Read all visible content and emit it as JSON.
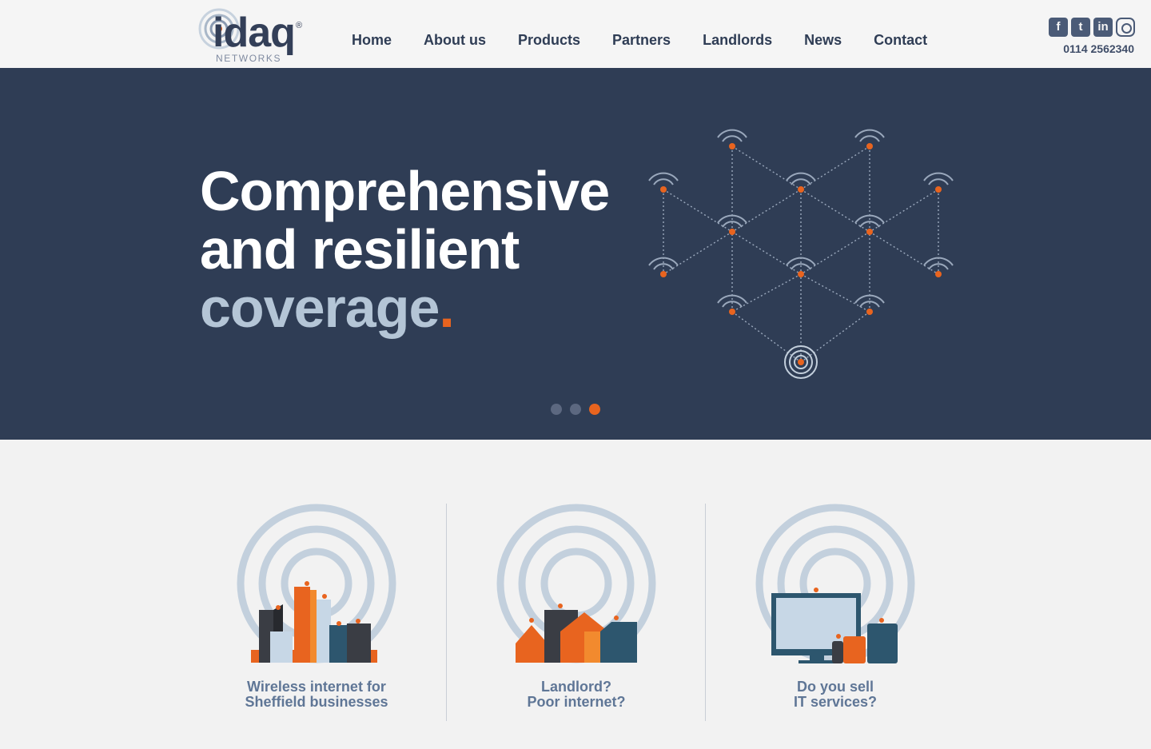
{
  "brand": {
    "name": "idaq",
    "subtitle": "NETWORKS",
    "registered": "®"
  },
  "nav": {
    "items": [
      {
        "label": "Home"
      },
      {
        "label": "About us"
      },
      {
        "label": "Products"
      },
      {
        "label": "Partners"
      },
      {
        "label": "Landlords"
      },
      {
        "label": "News"
      },
      {
        "label": "Contact"
      }
    ]
  },
  "social": {
    "icons": [
      "facebook-icon",
      "twitter-icon",
      "linkedin-icon",
      "instagram-icon"
    ],
    "phone": "0114 2562340"
  },
  "hero": {
    "line1": "Comprehensive",
    "line2": "and resilient",
    "line3": "coverage",
    "punct": ".",
    "slides": {
      "total": 3,
      "active": 3
    }
  },
  "features": [
    {
      "line1": "Wireless internet for",
      "line2": "Sheffield businesses"
    },
    {
      "line1": "Landlord?",
      "line2": "Poor internet?"
    },
    {
      "line1": "Do you sell",
      "line2": "IT services?"
    }
  ],
  "colors": {
    "navy": "#2f3d55",
    "orange": "#e8641f",
    "light_blue": "#b4c5d6",
    "caption_blue": "#5f7696"
  }
}
